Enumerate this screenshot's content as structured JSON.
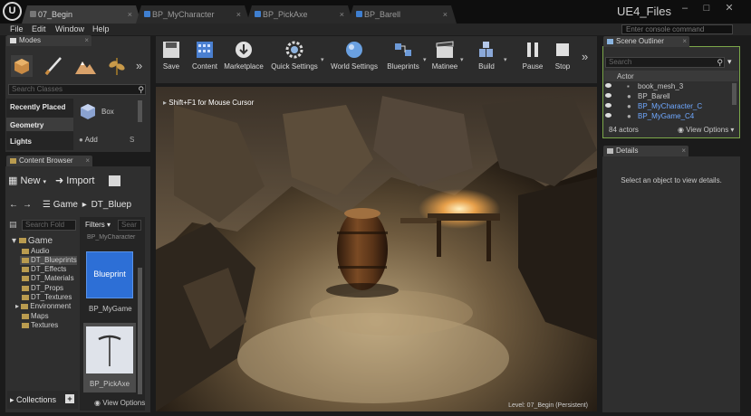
{
  "tabs": [
    {
      "label": "07_Begin",
      "active": true
    },
    {
      "label": "BP_MyCharacter",
      "active": false
    },
    {
      "label": "BP_PickAxe",
      "active": false
    },
    {
      "label": "BP_Barell",
      "active": false
    }
  ],
  "app_title": "UE4_Files",
  "menu": [
    "File",
    "Edit",
    "Window",
    "Help"
  ],
  "console_placeholder": "Enter console command",
  "modes": {
    "tab_label": "Modes",
    "search_placeholder": "Search Classes",
    "categories": [
      "Recently Placed",
      "Geometry",
      "Lights"
    ],
    "items": [
      "Box",
      "Add",
      "S"
    ]
  },
  "toolbar": {
    "buttons": [
      "Save",
      "Content",
      "Marketplace",
      "Quick Settings",
      "World Settings",
      "Blueprints",
      "Matinee",
      "Build",
      "Pause",
      "Stop"
    ]
  },
  "viewport": {
    "hint": "Shift+F1 for Mouse Cursor",
    "level": "Level: 07_Begin (Persistent)"
  },
  "outliner": {
    "tab_label": "Scene Outliner",
    "search_placeholder": "Search",
    "column": "Actor",
    "rows": [
      {
        "name": "book_mesh_3",
        "blueprint": false
      },
      {
        "name": "BP_Barell",
        "blueprint": false
      },
      {
        "name": "BP_MyCharacter_C",
        "blueprint": true
      },
      {
        "name": "BP_MyGame_C4",
        "blueprint": true
      }
    ],
    "count": "84 actors",
    "view_options": "View Options"
  },
  "details": {
    "tab_label": "Details",
    "empty_message": "Select an object to view details."
  },
  "content_browser": {
    "tab_label": "Content Browser",
    "new_label": "New",
    "import_label": "Import",
    "path": [
      "Game",
      "DT_Bluep"
    ],
    "search_folders": "Search Fold",
    "filters": "Filters",
    "search_assets": "Sear",
    "tree": {
      "root": "Game",
      "children": [
        "Audio",
        "DT_Blueprints",
        "DT_Effects",
        "DT_Materials",
        "DT_Props",
        "DT_Textures",
        "Environment",
        "Maps",
        "Textures"
      ]
    },
    "assets": [
      {
        "thumb_label": "Blueprint",
        "name": "BP_MyGame"
      },
      {
        "thumb_label": "",
        "name": "BP_PickAxe"
      }
    ],
    "partial_asset": "BP_MyCharacter",
    "collections": "Collections",
    "view_options": "View Options"
  },
  "colors": {
    "accent": "#2d6fd6",
    "blueprint_text": "#6fa8ff",
    "folder": "#b99b4f",
    "panel": "#2f2f2f",
    "outliner_border": "#7ca84a"
  }
}
